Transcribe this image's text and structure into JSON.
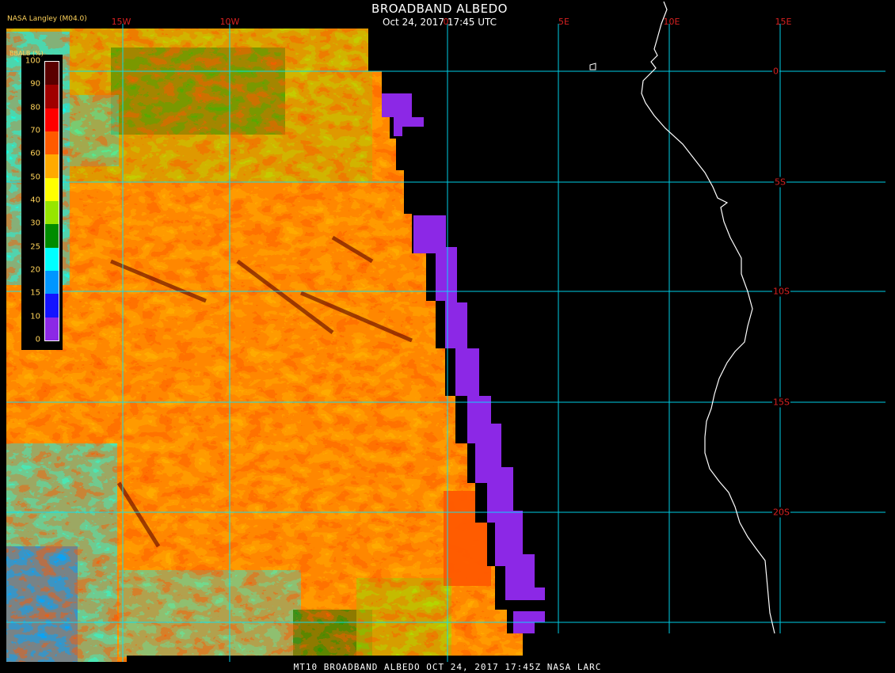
{
  "title": "BROADBAND ALBEDO",
  "timestamp": "Oct 24, 2017 17:45 UTC",
  "source_label": "NASA Langley (M04.0)",
  "footer": "MT10  BROADBAND ALBEDO  OCT 24, 2017 17:45Z  NASA LARC",
  "legend": {
    "title": "BBALB (%)",
    "ticks": [
      "100",
      "90",
      "80",
      "70",
      "60",
      "50",
      "40",
      "30",
      "25",
      "20",
      "15",
      "10",
      "0"
    ],
    "colors": [
      "#5a0000",
      "#a00000",
      "#ff0000",
      "#ff5a00",
      "#ffaa00",
      "#ffff00",
      "#96e600",
      "#008c00",
      "#00ffff",
      "#0096ff",
      "#1414ff",
      "#8c28e6"
    ]
  },
  "longitude_labels": [
    "15W",
    "10W",
    "0",
    "5E",
    "10E",
    "15E"
  ],
  "latitude_labels": [
    "0",
    "5S",
    "10S",
    "15S",
    "20S"
  ],
  "colors": {
    "background": "#000000",
    "grid": "#00e5ff",
    "grid_labels": "#d62020",
    "coastline": "#ffffff",
    "no_data_swath": "#8c28e6"
  }
}
